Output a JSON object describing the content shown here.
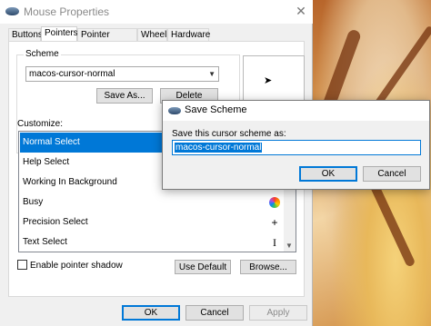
{
  "window": {
    "title": "Mouse Properties",
    "close_glyph": "✕",
    "tabs": [
      "Buttons",
      "Pointers",
      "Pointer Options",
      "Wheel",
      "Hardware"
    ],
    "active_tab": "Pointers"
  },
  "scheme": {
    "label": "Scheme",
    "selected": "macos-cursor-normal",
    "save_as_label": "Save As...",
    "delete_label": "Delete"
  },
  "customize": {
    "label": "Customize:",
    "rows": [
      {
        "label": "Normal Select",
        "icon": "arrow-cursor-icon",
        "selected": true
      },
      {
        "label": "Help Select",
        "icon": "help-cursor-icon"
      },
      {
        "label": "Working In Background",
        "icon": "working-cursor-icon"
      },
      {
        "label": "Busy",
        "icon": "busy-wheel-icon",
        "glyph": ""
      },
      {
        "label": "Precision Select",
        "icon": "crosshair-cursor-icon",
        "glyph": "+"
      },
      {
        "label": "Text Select",
        "icon": "ibeam-cursor-icon",
        "glyph": "I"
      }
    ]
  },
  "options": {
    "shadow_label": "Enable pointer shadow",
    "shadow_checked": false,
    "use_default_label": "Use Default",
    "browse_label": "Browse..."
  },
  "footer": {
    "ok_label": "OK",
    "cancel_label": "Cancel",
    "apply_label": "Apply"
  },
  "dialog": {
    "title": "Save Scheme",
    "prompt": "Save this cursor scheme as:",
    "input_value": "macos-cursor-normal",
    "ok_label": "OK",
    "cancel_label": "Cancel"
  },
  "colors": {
    "accent": "#0078d7",
    "window_bg": "#f0f0f0"
  }
}
